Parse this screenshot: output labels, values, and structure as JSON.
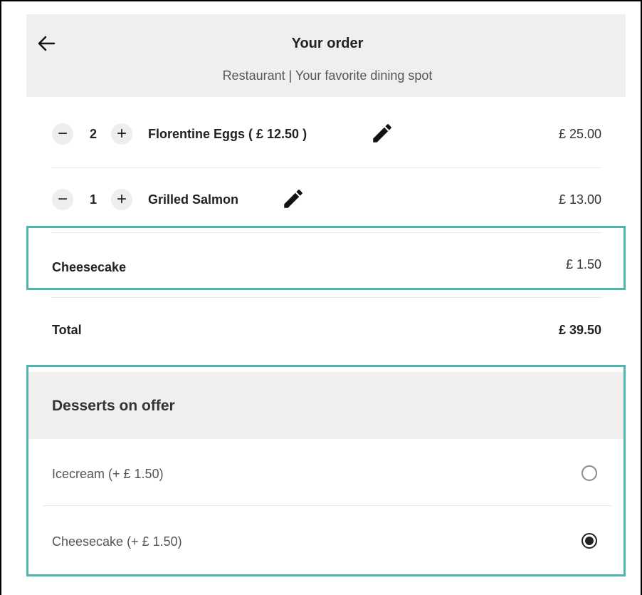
{
  "header": {
    "title": "Your order",
    "subtitle": "Restaurant | Your favorite dining spot",
    "back_icon": "arrow-left-icon"
  },
  "order": {
    "items": [
      {
        "qty": "2",
        "minus": "−",
        "plus": "+",
        "name": "Florentine Eggs ( £ 12.50 )",
        "price": "£ 25.00",
        "edit_icon": "pencil-icon"
      },
      {
        "qty": "1",
        "minus": "−",
        "plus": "+",
        "name": "Grilled Salmon",
        "price": "£ 13.00",
        "edit_icon": "pencil-icon"
      }
    ],
    "dessert_line": {
      "name": "Cheesecake",
      "price": "£ 1.50"
    },
    "total": {
      "label": "Total",
      "value": "£ 39.50"
    }
  },
  "desserts": {
    "title": "Desserts on offer",
    "options": [
      {
        "label": "Icecream (+ £ 1.50)",
        "selected": false
      },
      {
        "label": "Cheesecake (+ £ 1.50)",
        "selected": true
      }
    ]
  },
  "colors": {
    "highlight": "#4db6ac",
    "header_bg": "#f0efed"
  }
}
